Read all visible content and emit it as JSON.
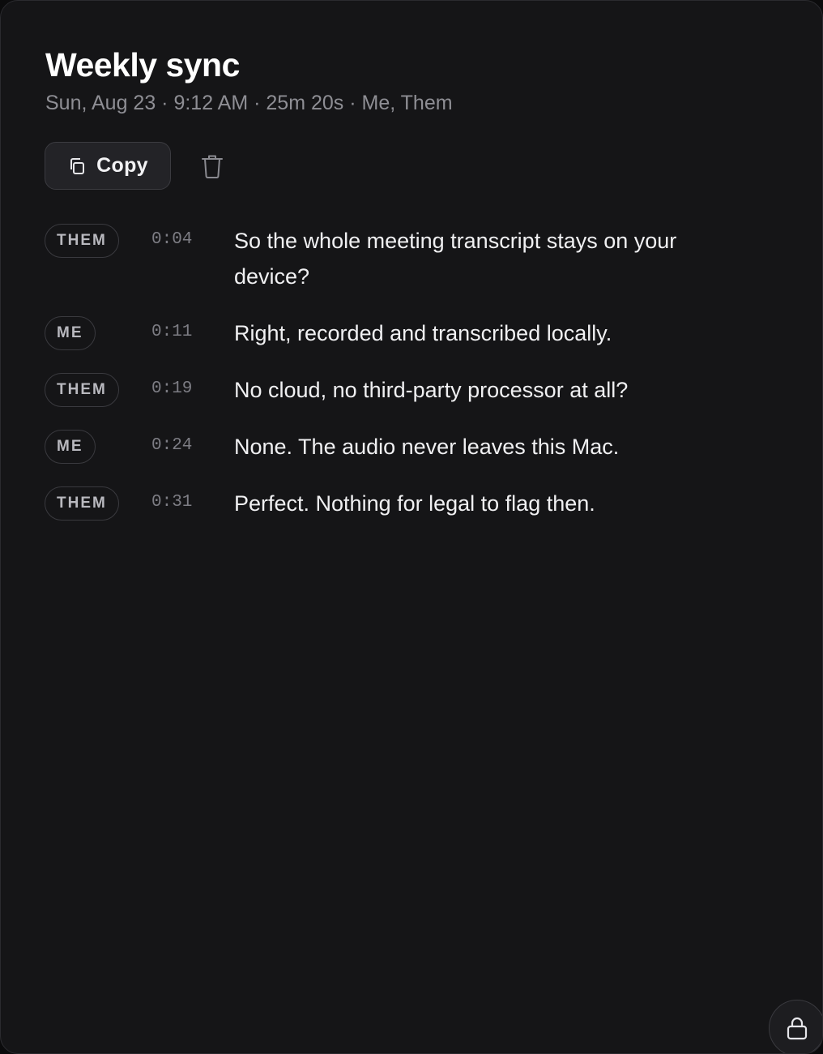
{
  "header": {
    "title": "Weekly sync",
    "meta": "Sun, Aug 23 · 9:12 AM · 25m 20s · Me, Them"
  },
  "toolbar": {
    "copy_label": "Copy",
    "copy_icon": "copy-icon",
    "delete_icon": "trash-icon"
  },
  "transcript": [
    {
      "speaker": "THEM",
      "time": "0:04",
      "text": "So the whole meeting transcript stays on your device?"
    },
    {
      "speaker": "ME",
      "time": "0:11",
      "text": "Right, recorded and transcribed locally."
    },
    {
      "speaker": "THEM",
      "time": "0:19",
      "text": "No cloud, no third-party processor at all?"
    },
    {
      "speaker": "ME",
      "time": "0:24",
      "text": "None. The audio never leaves this Mac."
    },
    {
      "speaker": "THEM",
      "time": "0:31",
      "text": "Perfect. Nothing for legal to flag then."
    }
  ],
  "footer": {
    "lock_icon": "lock-icon"
  },
  "colors": {
    "background": "#151517",
    "text_primary": "#f2f2f4",
    "text_secondary": "#8e8e94",
    "badge_border": "#3a3a3f"
  }
}
